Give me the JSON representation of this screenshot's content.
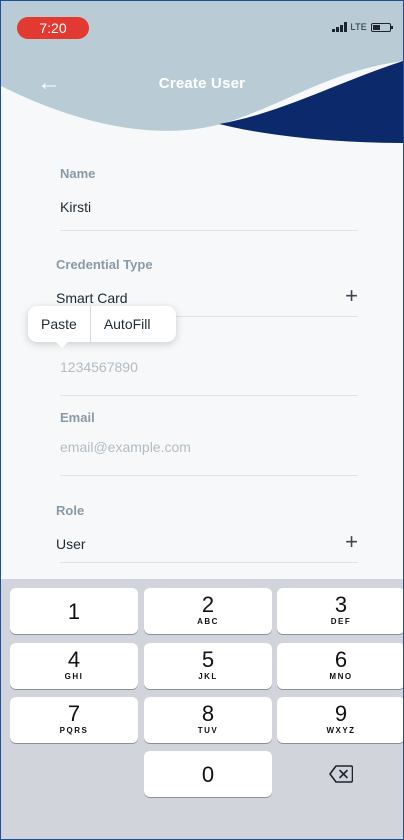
{
  "status_bar": {
    "time": "7:20",
    "network": "LTE"
  },
  "header": {
    "title": "Create User",
    "back_icon": "back-arrow-icon"
  },
  "form": {
    "name": {
      "label": "Name",
      "value": "Kirsti"
    },
    "credential_type": {
      "label": "Credential Type",
      "value": "Smart Card"
    },
    "credential_number": {
      "placeholder": "1234567890"
    },
    "email": {
      "label": "Email",
      "placeholder": "email@example.com"
    },
    "role": {
      "label": "Role",
      "value": "User"
    },
    "add_symbol": "+"
  },
  "context_menu": {
    "paste": "Paste",
    "autofill": "AutoFill"
  },
  "keypad": {
    "keys": [
      {
        "num": "1",
        "letters": ""
      },
      {
        "num": "2",
        "letters": "ABC"
      },
      {
        "num": "3",
        "letters": "DEF"
      },
      {
        "num": "4",
        "letters": "GHI"
      },
      {
        "num": "5",
        "letters": "JKL"
      },
      {
        "num": "6",
        "letters": "MNO"
      },
      {
        "num": "7",
        "letters": "PQRS"
      },
      {
        "num": "8",
        "letters": "TUV"
      },
      {
        "num": "9",
        "letters": "WXYZ"
      },
      {
        "num": "0",
        "letters": ""
      }
    ],
    "delete_icon": "backspace-icon"
  },
  "colors": {
    "header_light": "#b9ccd6",
    "header_dark": "#0c2a6b",
    "status_pill": "#e23a30",
    "keypad_bg": "#d1d5db"
  }
}
